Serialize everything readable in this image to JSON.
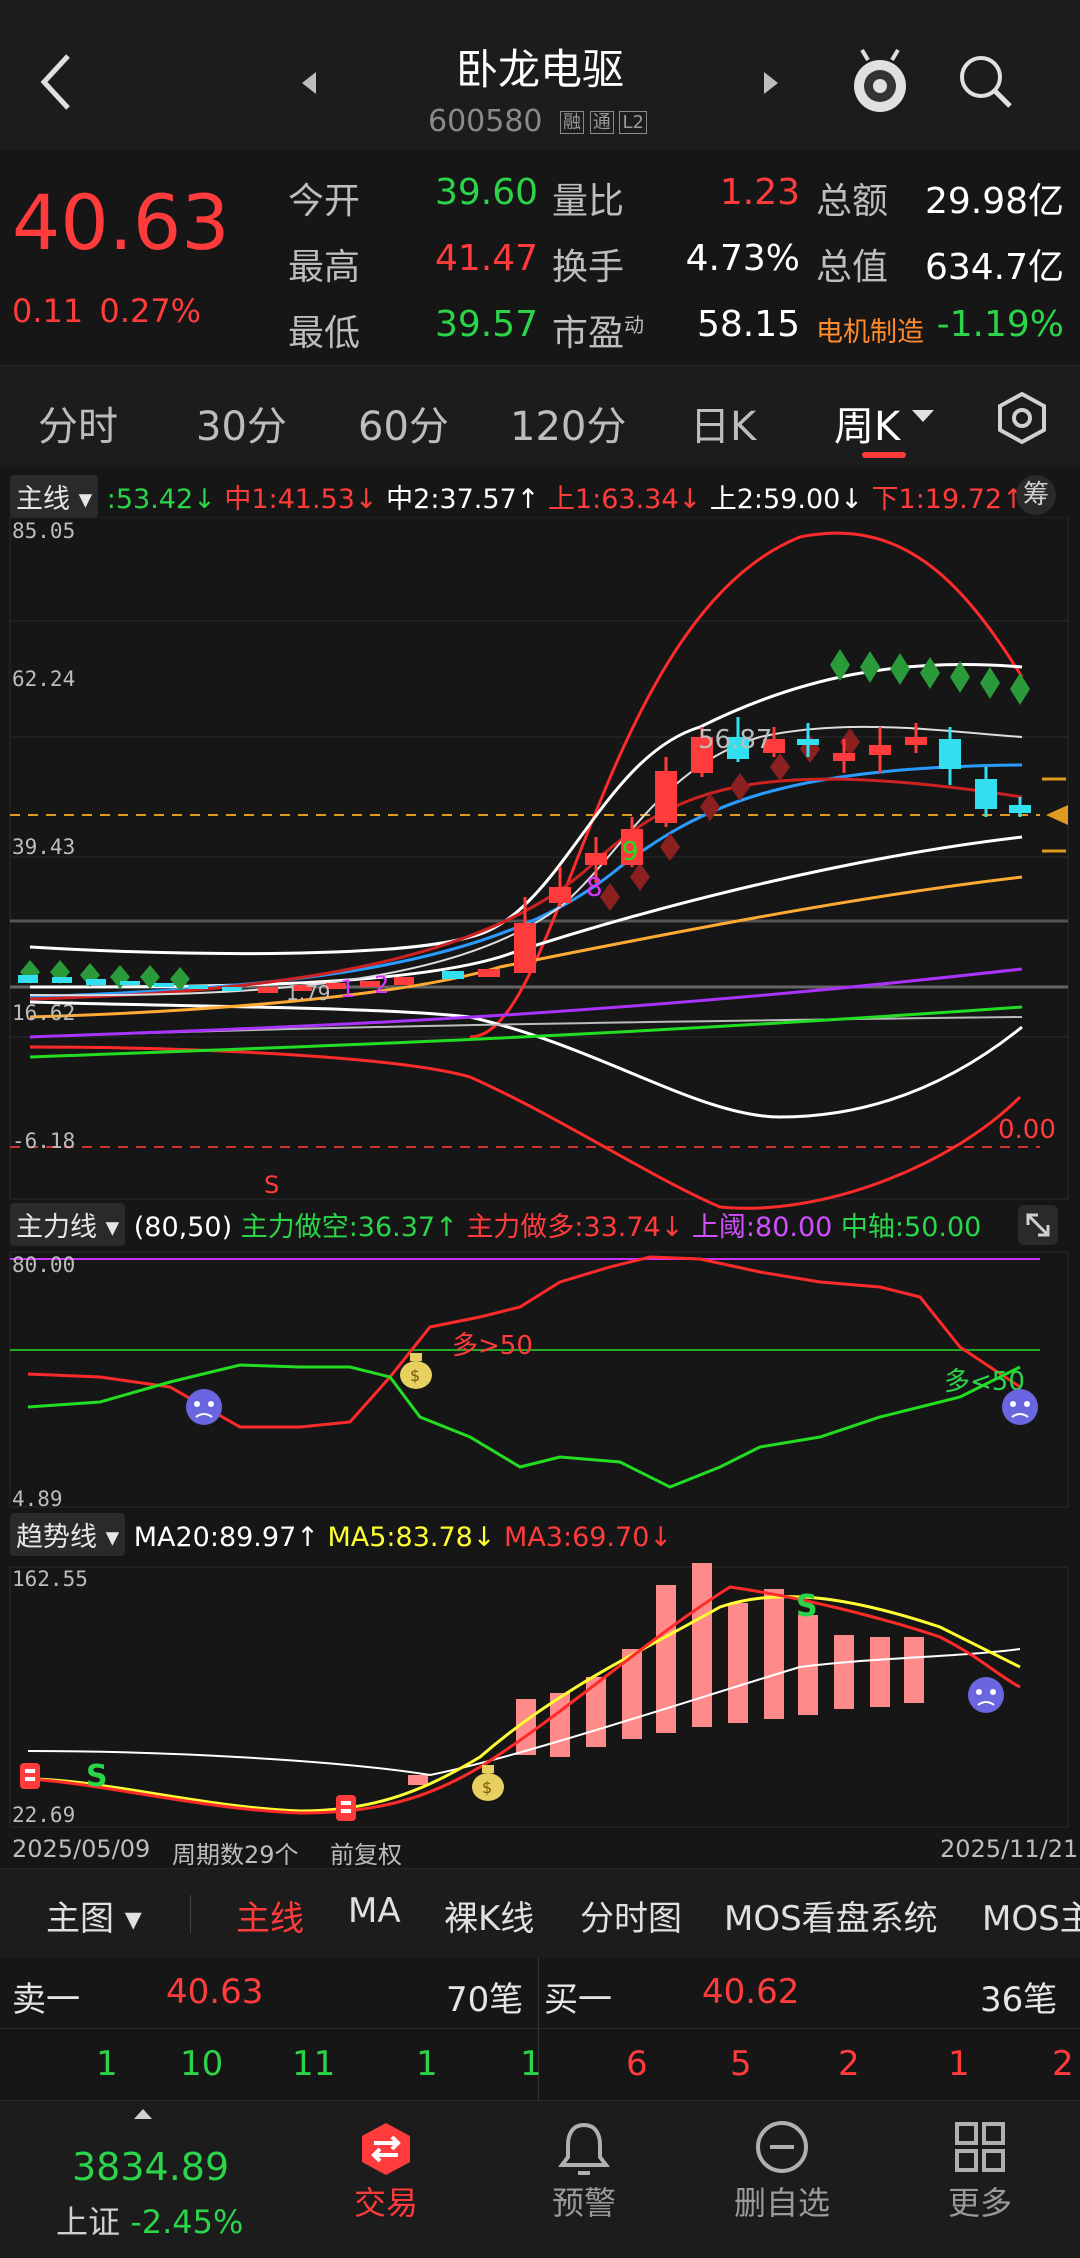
{
  "header": {
    "stock_name": "卧龙电驱",
    "stock_code": "600580",
    "tags": [
      "融",
      "通",
      "L2"
    ]
  },
  "quote": {
    "price": "40.63",
    "change": "0.11",
    "change_pct": "0.27%",
    "stats": [
      {
        "label": "今开",
        "value": "39.60",
        "color": "#2bd448"
      },
      {
        "label": "最高",
        "value": "41.47",
        "color": "#ff3b3b"
      },
      {
        "label": "最低",
        "value": "39.57",
        "color": "#2bd448"
      },
      {
        "label": "量比",
        "value": "1.23",
        "color": "#ff3b3b"
      },
      {
        "label": "换手",
        "value": "4.73%",
        "color": "#ffffff"
      },
      {
        "label": "市盈",
        "sup": "动",
        "value": "58.15",
        "color": "#ffffff"
      },
      {
        "label": "总额",
        "value": "29.98亿",
        "color": "#ffffff"
      },
      {
        "label": "总值",
        "value": "634.7亿",
        "color": "#ffffff"
      },
      {
        "label": "电机制造",
        "value": "-1.19%",
        "color": "#2bd448"
      }
    ]
  },
  "period_tabs": [
    "分时",
    "30分",
    "60分",
    "120分",
    "日K",
    "周K"
  ],
  "main_panel": {
    "selector": "主线",
    "legend": [
      {
        "text": ":53.42↓",
        "color": "#2bd448"
      },
      {
        "text": "中1:41.53↓",
        "color": "#ff3b3b"
      },
      {
        "text": "中2:37.57↑",
        "color": "#ffffff"
      },
      {
        "text": "上1:63.34↓",
        "color": "#ff3b3b"
      },
      {
        "text": "上2:59.00↓",
        "color": "#ffffff"
      },
      {
        "text": "下1:19.72↑",
        "color": "#ff3b3b"
      }
    ],
    "chip_label": "筹",
    "y_ticks": [
      "85.05",
      "62.24",
      "39.43",
      "16.62",
      "-6.18"
    ],
    "price_label": "56.87",
    "markers": [
      "9",
      "8",
      "2",
      "1",
      "1.79",
      "S"
    ],
    "zero_label": "0.00"
  },
  "force_panel": {
    "selector": "主力线",
    "legend": [
      {
        "text": "(80,50)",
        "color": "#ffffff"
      },
      {
        "text": "主力做空:36.37↑",
        "color": "#2bd448"
      },
      {
        "text": "主力做多:33.74↓",
        "color": "#ff3b3b"
      },
      {
        "text": "上阈:80.00",
        "color": "#d050ff"
      },
      {
        "text": "中轴:50.00",
        "color": "#2bd448"
      }
    ],
    "y_ticks": [
      "80.00",
      "4.89"
    ],
    "annotations": [
      "多>50",
      "多<50"
    ]
  },
  "trend_panel": {
    "selector": "趋势线",
    "legend": [
      {
        "text": "MA20:89.97↑",
        "color": "#ffffff"
      },
      {
        "text": "MA5:83.78↓",
        "color": "#ffff33"
      },
      {
        "text": "MA3:69.70↓",
        "color": "#ff3b3b"
      }
    ],
    "y_ticks": [
      "162.55",
      "22.69"
    ],
    "markers": [
      "S",
      "S"
    ]
  },
  "footer_info": {
    "start_date": "2025/05/09",
    "period_count": "周期数29个",
    "adjust": "前复权",
    "end_date": "2025/11/21"
  },
  "chart_tabs": [
    "主图",
    "主线",
    "MA",
    "裸K线",
    "分时图",
    "MOS看盘系统",
    "MOS主"
  ],
  "orderbook": {
    "sell": {
      "label": "卖一",
      "price": "40.63",
      "count": "70笔",
      "lots": [
        "1",
        "10",
        "11",
        "1",
        "1"
      ]
    },
    "buy": {
      "label": "买一",
      "price": "40.62",
      "count": "36笔",
      "lots": [
        "6",
        "5",
        "2",
        "1",
        "2"
      ]
    }
  },
  "bottom_nav": {
    "index_value": "3834.89",
    "index_name": "上证",
    "index_change": "-2.45%",
    "items": [
      "交易",
      "预警",
      "删自选",
      "更多"
    ]
  },
  "colors": {
    "up": "#ff3b3b",
    "down": "#2bd448",
    "accent": "#ff3b3b",
    "cyan": "#33e0f0"
  }
}
